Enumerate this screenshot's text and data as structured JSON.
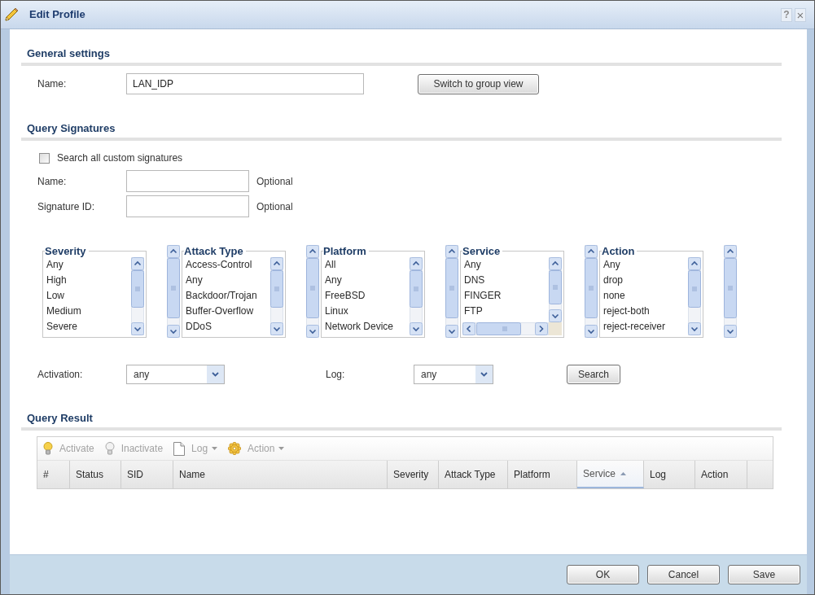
{
  "window": {
    "title": "Edit Profile",
    "help_button": "?",
    "close_button": "×"
  },
  "general_settings": {
    "heading": "General settings",
    "name": {
      "label": "Name:",
      "value": "LAN_IDP"
    },
    "switch_button": "Switch to group view"
  },
  "query_signatures": {
    "heading": "Query Signatures",
    "search_all": {
      "label": "Search all custom signatures",
      "checked": false
    },
    "fields": [
      {
        "label": "Name:",
        "note": "Optional"
      },
      {
        "label": "Signature ID:",
        "note": "Optional"
      }
    ],
    "filters": [
      {
        "title": "Severity",
        "items": [
          "Any",
          "High",
          "Low",
          "Medium",
          "Severe"
        ]
      },
      {
        "title": "Attack Type",
        "items": [
          "Access-Control",
          "Any",
          "Backdoor/Trojan",
          "Buffer-Overflow",
          "DDoS"
        ]
      },
      {
        "title": "Platform",
        "items": [
          "All",
          "Any",
          "FreeBSD",
          "Linux",
          "Network Device"
        ]
      },
      {
        "title": "Service",
        "items": [
          "Any",
          "DNS",
          "FINGER",
          "FTP"
        ]
      },
      {
        "title": "Action",
        "items": [
          "Any",
          "drop",
          "none",
          "reject-both",
          "reject-receiver"
        ]
      }
    ],
    "activation": {
      "label": "Activation:",
      "value": "any"
    },
    "log": {
      "label": "Log:",
      "value": "any"
    },
    "search_button": "Search"
  },
  "query_result": {
    "heading": "Query Result",
    "toolbar": [
      {
        "label": "Activate",
        "kind": "button",
        "disabled": true
      },
      {
        "label": "Inactivate",
        "kind": "button",
        "disabled": true
      },
      {
        "label": "Log",
        "kind": "menu",
        "disabled": true
      },
      {
        "label": "Action",
        "kind": "menu",
        "disabled": true
      }
    ],
    "columns": [
      {
        "label": "#",
        "sorted": false
      },
      {
        "label": "Status",
        "sorted": false
      },
      {
        "label": "SID",
        "sorted": false
      },
      {
        "label": "Name",
        "sorted": false
      },
      {
        "label": "Severity",
        "sorted": false
      },
      {
        "label": "Attack Type",
        "sorted": false
      },
      {
        "label": "Platform",
        "sorted": false
      },
      {
        "label": "Service",
        "sorted": true
      },
      {
        "label": "Log",
        "sorted": false
      },
      {
        "label": "Action",
        "sorted": false
      }
    ]
  },
  "footer_buttons": [
    "OK",
    "Cancel",
    "Save"
  ]
}
